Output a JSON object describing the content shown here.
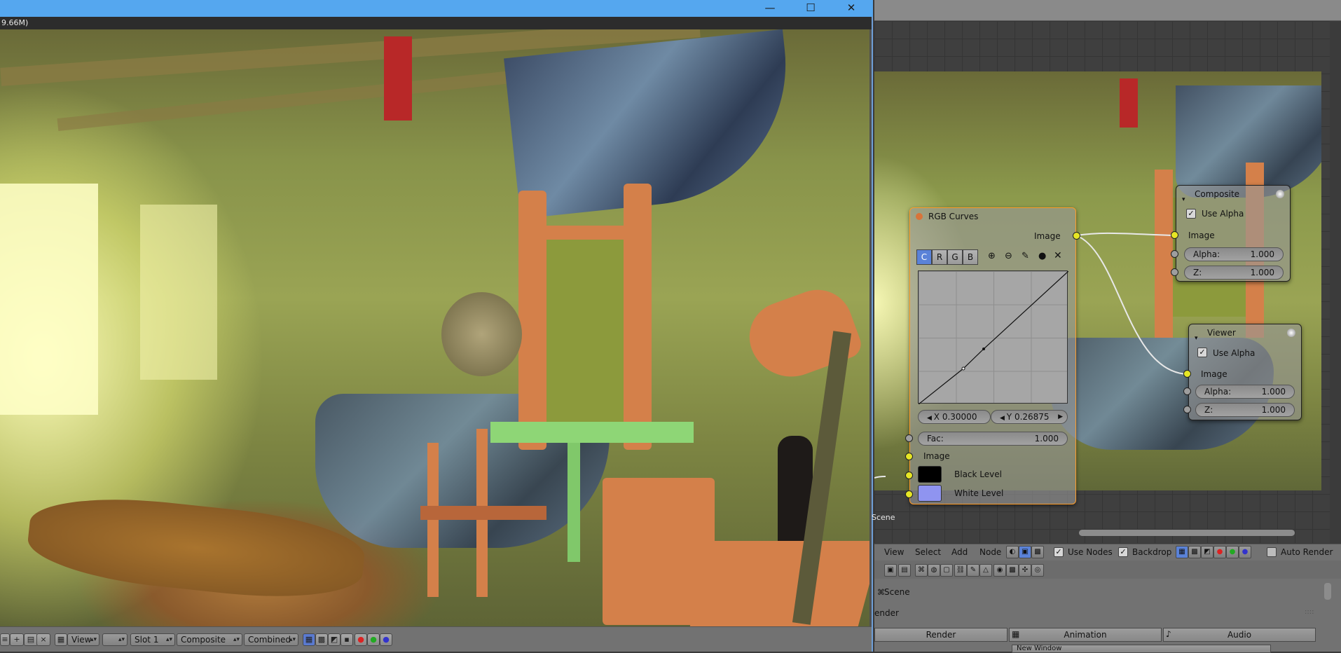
{
  "render_window": {
    "header_text": "9.66M)",
    "window_buttons": [
      "minimize",
      "maximize",
      "close"
    ],
    "minimize_glyph": "—",
    "maximize_glyph": "☐",
    "close_glyph": "✕",
    "footer": {
      "view_menu": "View",
      "slot": "Slot 1",
      "image": "Composite",
      "pass": "Combined"
    }
  },
  "node_editor": {
    "scene_label": "Scene",
    "nodes": {
      "rgb_curves": {
        "title": "RGB Curves",
        "output_image": "Image",
        "channels": [
          "C",
          "R",
          "G",
          "B"
        ],
        "x_field": "X 0.30000",
        "y_field": "Y 0.26875",
        "fac_label": "Fac:",
        "fac_value": "1.000",
        "input_image": "Image",
        "black_level": "Black Level",
        "white_level": "White Level",
        "black_color": "#000000",
        "white_color": "#8f94f0"
      },
      "composite": {
        "title": "Composite",
        "use_alpha": "Use Alpha",
        "image": "Image",
        "alpha_label": "Alpha:",
        "alpha_value": "1.000",
        "z_label": "Z:",
        "z_value": "1.000"
      },
      "viewer": {
        "title": "Viewer",
        "use_alpha": "Use Alpha",
        "image": "Image",
        "alpha_label": "Alpha:",
        "alpha_value": "1.000",
        "z_label": "Z:",
        "z_value": "1.000"
      }
    },
    "header": {
      "menus": [
        "View",
        "Select",
        "Add",
        "Node"
      ],
      "use_nodes": "Use Nodes",
      "backdrop": "Backdrop",
      "auto_render": "Auto Render"
    },
    "properties": {
      "scene": "Scene",
      "render_section": "ender",
      "tabs": [
        "Render",
        "Animation",
        "Audio"
      ],
      "new_window": "New Window"
    }
  },
  "colors": {
    "title_bar": "#55a7ef",
    "socket_yellow": "#e6e625",
    "active_node_border": "#ff9c28"
  }
}
